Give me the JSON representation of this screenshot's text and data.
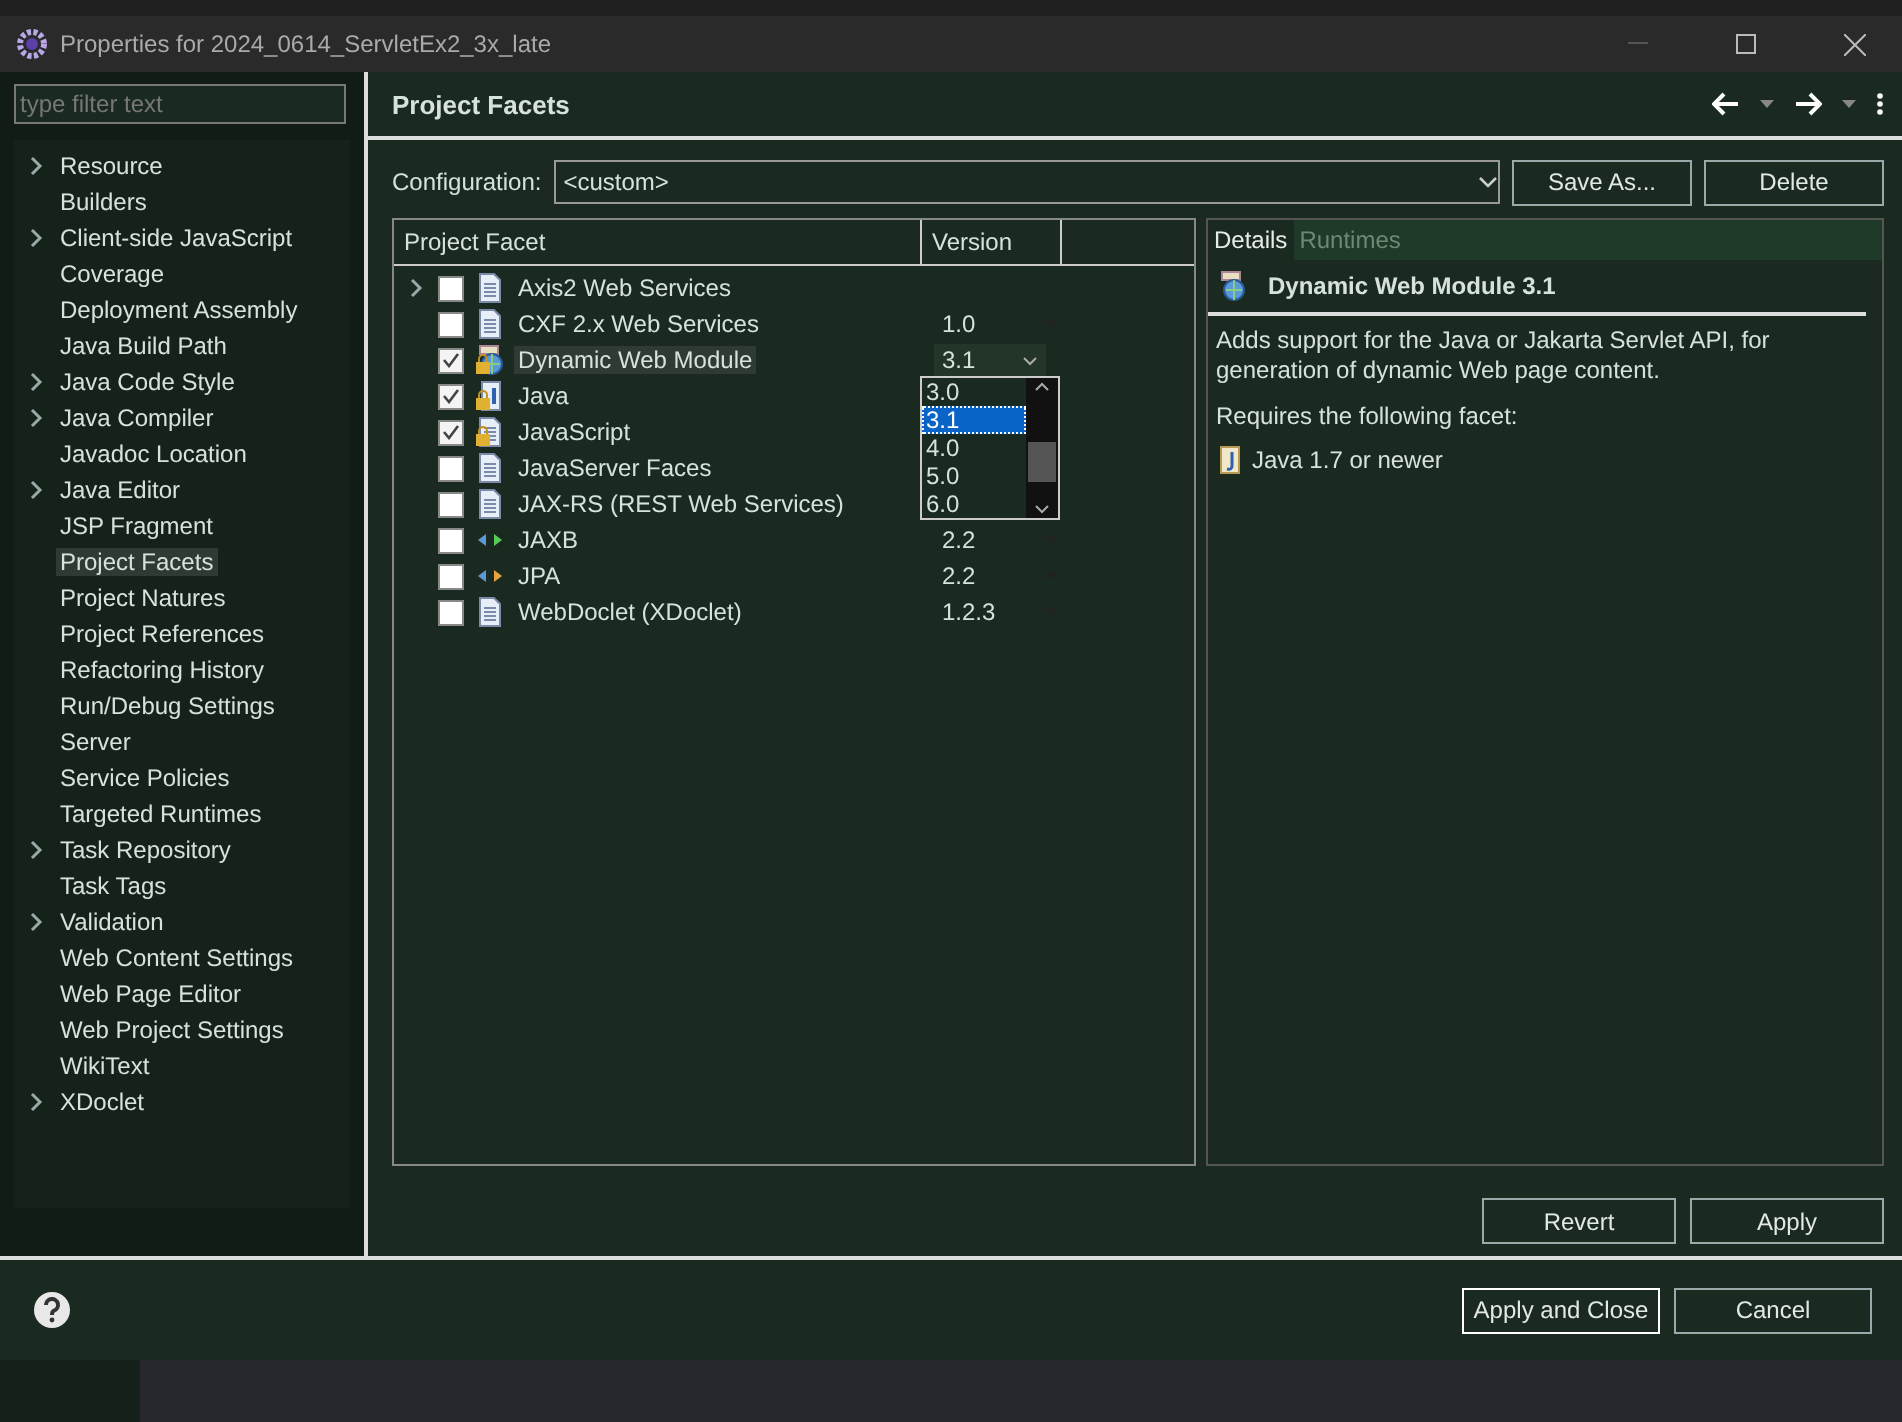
{
  "window": {
    "title": "Properties for 2024_0614_ServletEx2_3x_late"
  },
  "sidebar": {
    "filter_placeholder": "type filter text",
    "items": [
      {
        "label": "Resource",
        "expandable": true,
        "selected": false
      },
      {
        "label": "Builders",
        "expandable": false,
        "selected": false
      },
      {
        "label": "Client-side JavaScript",
        "expandable": true,
        "selected": false
      },
      {
        "label": "Coverage",
        "expandable": false,
        "selected": false
      },
      {
        "label": "Deployment Assembly",
        "expandable": false,
        "selected": false
      },
      {
        "label": "Java Build Path",
        "expandable": false,
        "selected": false
      },
      {
        "label": "Java Code Style",
        "expandable": true,
        "selected": false
      },
      {
        "label": "Java Compiler",
        "expandable": true,
        "selected": false
      },
      {
        "label": "Javadoc Location",
        "expandable": false,
        "selected": false
      },
      {
        "label": "Java Editor",
        "expandable": true,
        "selected": false
      },
      {
        "label": "JSP Fragment",
        "expandable": false,
        "selected": false
      },
      {
        "label": "Project Facets",
        "expandable": false,
        "selected": true
      },
      {
        "label": "Project Natures",
        "expandable": false,
        "selected": false
      },
      {
        "label": "Project References",
        "expandable": false,
        "selected": false
      },
      {
        "label": "Refactoring History",
        "expandable": false,
        "selected": false
      },
      {
        "label": "Run/Debug Settings",
        "expandable": false,
        "selected": false
      },
      {
        "label": "Server",
        "expandable": false,
        "selected": false
      },
      {
        "label": "Service Policies",
        "expandable": false,
        "selected": false
      },
      {
        "label": "Targeted Runtimes",
        "expandable": false,
        "selected": false
      },
      {
        "label": "Task Repository",
        "expandable": true,
        "selected": false
      },
      {
        "label": "Task Tags",
        "expandable": false,
        "selected": false
      },
      {
        "label": "Validation",
        "expandable": true,
        "selected": false
      },
      {
        "label": "Web Content Settings",
        "expandable": false,
        "selected": false
      },
      {
        "label": "Web Page Editor",
        "expandable": false,
        "selected": false
      },
      {
        "label": "Web Project Settings",
        "expandable": false,
        "selected": false
      },
      {
        "label": "WikiText",
        "expandable": false,
        "selected": false
      },
      {
        "label": "XDoclet",
        "expandable": true,
        "selected": false
      }
    ]
  },
  "page": {
    "title": "Project Facets",
    "configuration": {
      "label": "Configuration:",
      "value": "<custom>",
      "buttons": [
        "Save As...",
        "Delete"
      ]
    },
    "facets_table": {
      "columns": [
        "Project Facet",
        "Version"
      ],
      "rows": [
        {
          "name": "Axis2 Web Services",
          "kind": "document",
          "expandable": true,
          "checked": false,
          "locked": false,
          "selected": false
        },
        {
          "name": "CXF 2.x Web Services",
          "kind": "document",
          "expandable": false,
          "checked": false,
          "locked": false,
          "selected": false,
          "version": "1.0"
        },
        {
          "name": "Dynamic Web Module",
          "kind": "module",
          "expandable": false,
          "checked": true,
          "locked": true,
          "selected": true,
          "version": "3.1",
          "editing": true
        },
        {
          "name": "Java",
          "kind": "java",
          "expandable": false,
          "checked": true,
          "locked": true,
          "selected": false
        },
        {
          "name": "JavaScript",
          "kind": "document",
          "expandable": false,
          "checked": true,
          "locked": true,
          "selected": false
        },
        {
          "name": "JavaServer Faces",
          "kind": "document",
          "expandable": false,
          "checked": false,
          "locked": false,
          "selected": false
        },
        {
          "name": "JAX-RS (REST Web Services)",
          "kind": "document",
          "expandable": false,
          "checked": false,
          "locked": false,
          "selected": false
        },
        {
          "name": "JAXB",
          "kind": "binding",
          "expandable": false,
          "checked": false,
          "locked": false,
          "selected": false,
          "version": "2.2"
        },
        {
          "name": "JPA",
          "kind": "persistence",
          "expandable": false,
          "checked": false,
          "locked": false,
          "selected": false,
          "version": "2.2"
        },
        {
          "name": "WebDoclet (XDoclet)",
          "kind": "document",
          "expandable": false,
          "checked": false,
          "locked": false,
          "selected": false,
          "version": "1.2.3"
        }
      ],
      "version_list": [
        {
          "label": "3.0",
          "selected": false
        },
        {
          "label": "3.1",
          "selected": true
        },
        {
          "label": "4.0",
          "selected": false
        },
        {
          "label": "5.0",
          "selected": false
        },
        {
          "label": "6.0",
          "selected": false
        }
      ]
    },
    "details": {
      "tabs": [
        {
          "label": "Details",
          "selected": true
        },
        {
          "label": "Runtimes",
          "selected": false
        }
      ],
      "title": "Dynamic Web Module 3.1",
      "description": "Adds support for the Java or Jakarta Servlet API, for generation of dynamic Web page content.",
      "requires_label": "Requires the following facet:",
      "requirements": [
        "Java 1.7 or newer"
      ]
    },
    "buttons": [
      "Revert",
      "Apply"
    ]
  },
  "footer": {
    "buttons": [
      {
        "label": "Apply and Close",
        "default": true
      },
      {
        "label": "Cancel",
        "default": false
      }
    ]
  }
}
